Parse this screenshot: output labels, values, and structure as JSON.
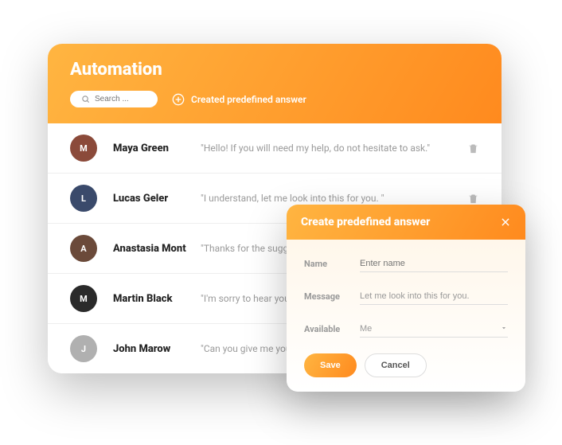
{
  "header": {
    "title": "Automation",
    "search_placeholder": "Search ...",
    "create_label": "Created predefined answer"
  },
  "answers": [
    {
      "name": "Maya Green",
      "message": "\"Hello! If you will need my help, do not hesitate to ask.\"",
      "avatar_bg": "#8b4a3a",
      "avatar_initial": "M",
      "show_trash": true
    },
    {
      "name": "Lucas Geler",
      "message": "\"I understand, let me look into this for you. \"",
      "avatar_bg": "#3a4a6b",
      "avatar_initial": "L",
      "show_trash": true
    },
    {
      "name": "Anastasia Mont",
      "message": "\"Thanks for the suggestion, I'll pass it along.\"",
      "avatar_bg": "#6b4a3a",
      "avatar_initial": "A",
      "show_trash": false
    },
    {
      "name": "Martin Black",
      "message": "\"I'm sorry to hear you're having trouble.\"",
      "avatar_bg": "#2a2a2a",
      "avatar_initial": "M",
      "show_trash": false
    },
    {
      "name": "John Marow",
      "message": "\"Can you give me your order number?\"",
      "avatar_bg": "#b0b0b0",
      "avatar_initial": "J",
      "show_trash": false
    }
  ],
  "modal": {
    "title": "Create predefined answer",
    "name_label": "Name",
    "name_placeholder": "Enter name",
    "message_label": "Message",
    "message_value": "Let me look into this for you.",
    "available_label": "Available",
    "available_value": "Me",
    "save_label": "Save",
    "cancel_label": "Cancel"
  },
  "colors": {
    "gradient_start": "#ffb541",
    "gradient_end": "#ff8a1e"
  }
}
